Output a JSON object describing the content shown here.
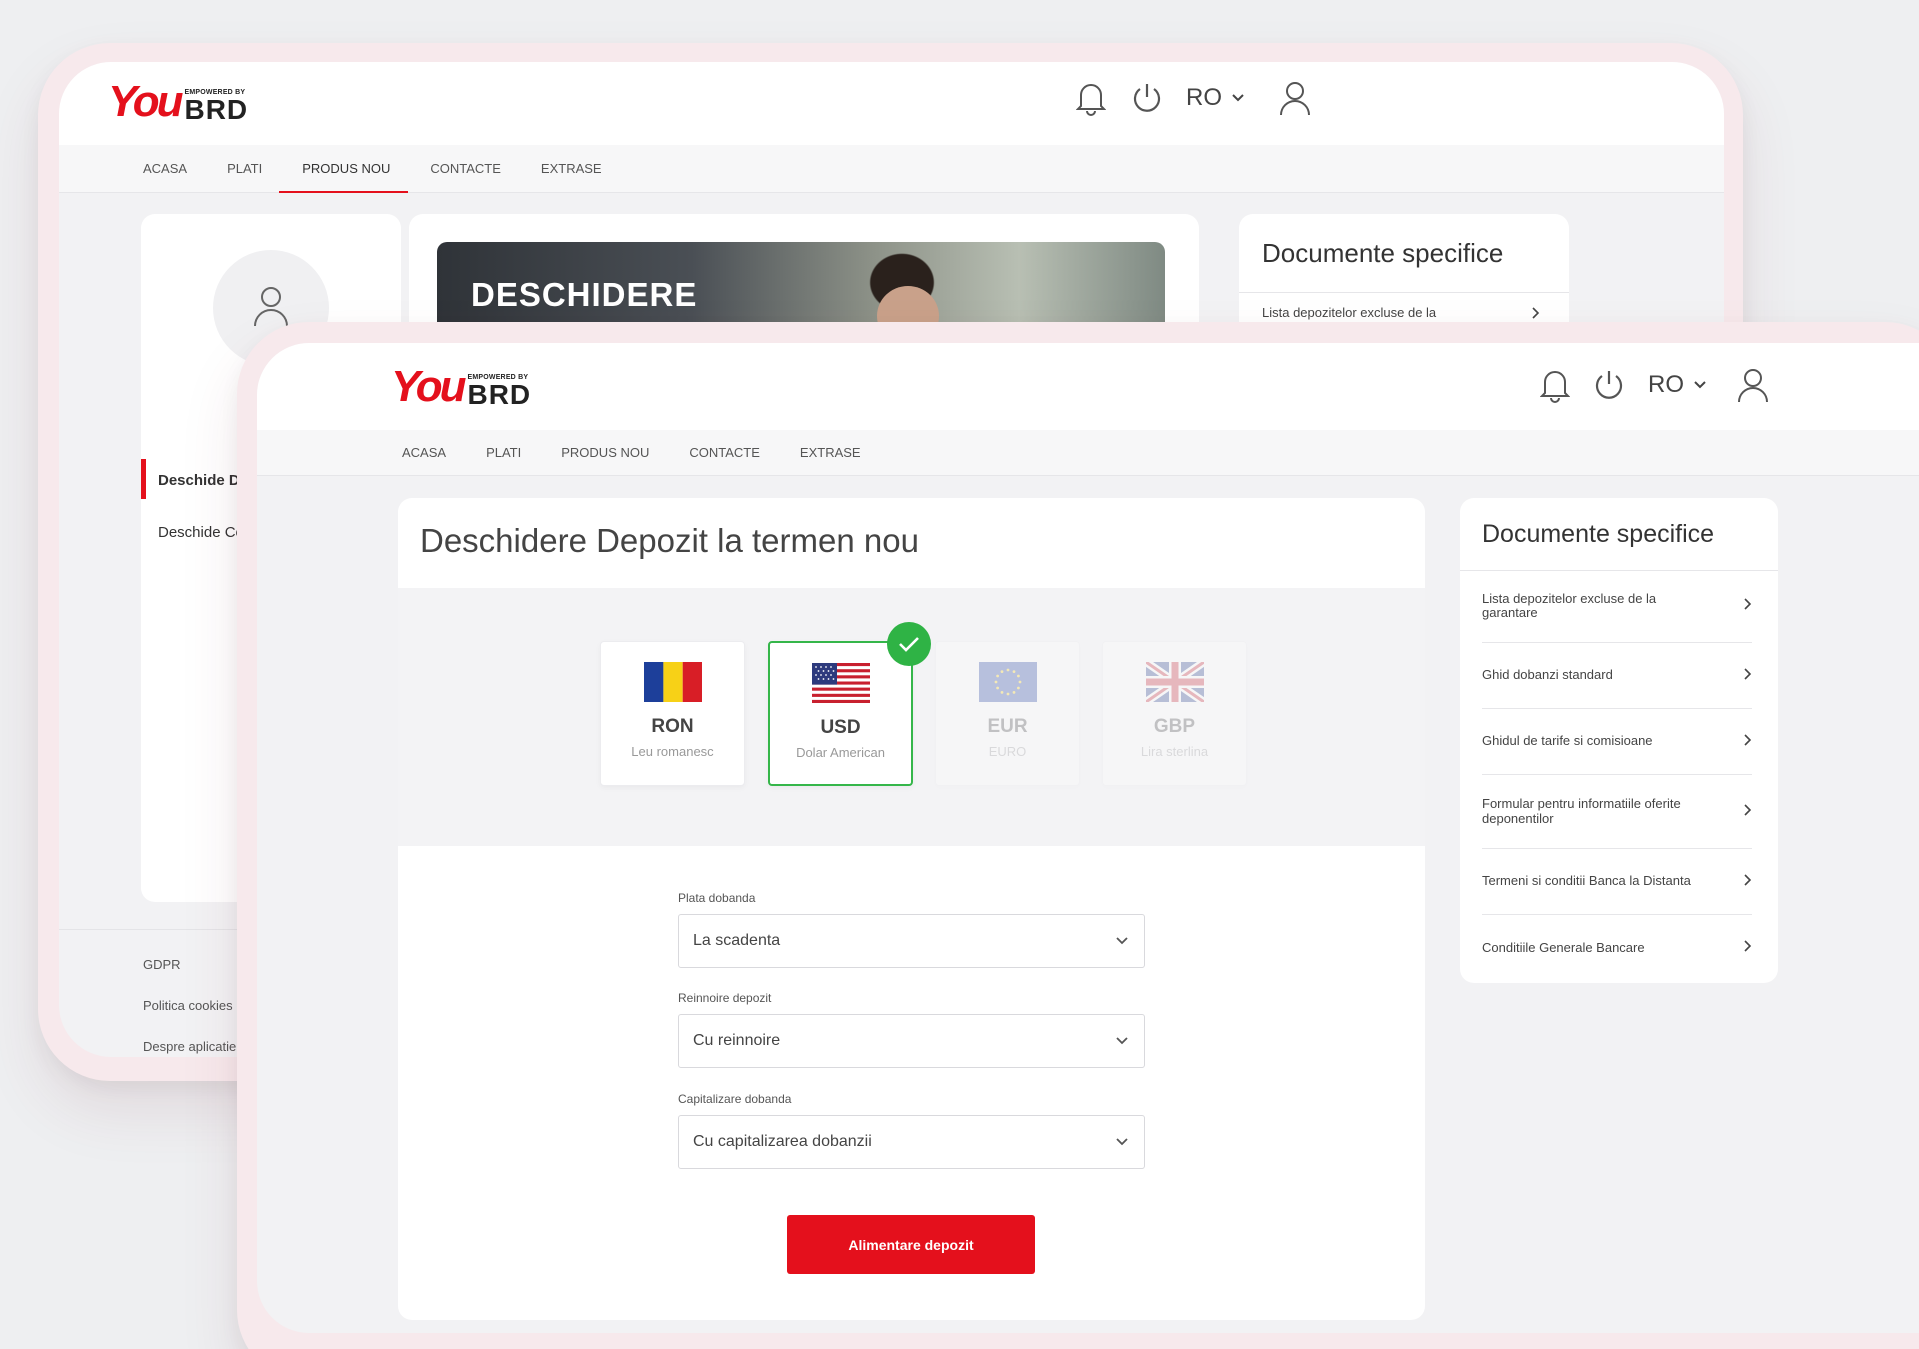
{
  "brand": {
    "logo_main": "You",
    "logo_tag": "EMPOWERED BY",
    "logo_bank": "BRD",
    "accent_color": "#e4101c",
    "success_color": "#2fb345"
  },
  "header": {
    "language": "RO",
    "icons": [
      "bell-icon",
      "power-icon",
      "chevron-down-icon",
      "user-icon"
    ]
  },
  "nav": {
    "items": [
      {
        "label": "ACASA"
      },
      {
        "label": "PLATI"
      },
      {
        "label": "PRODUS NOU"
      },
      {
        "label": "CONTACTE"
      },
      {
        "label": "EXTRASE"
      }
    ],
    "active_index_back": 2
  },
  "back_screen": {
    "banner_title": "DESCHIDERE",
    "sidebar": {
      "items": [
        {
          "label": "Deschide D",
          "active": true
        },
        {
          "label": "Deschide Co",
          "active": false
        }
      ]
    },
    "docs_title": "Documente specifice",
    "docs_first": "Lista depozitelor excluse de la",
    "footer": [
      "GDPR",
      "Politica cookies",
      "Despre aplicatie"
    ]
  },
  "main": {
    "title": "Deschidere Depozit la termen nou",
    "currencies": [
      {
        "code": "RON",
        "name": "Leu romanesc",
        "flag": "ro-flag",
        "state": "available"
      },
      {
        "code": "USD",
        "name": "Dolar American",
        "flag": "us-flag",
        "state": "selected"
      },
      {
        "code": "EUR",
        "name": "EURO",
        "flag": "eu-flag",
        "state": "disabled"
      },
      {
        "code": "GBP",
        "name": "Lira sterlina",
        "flag": "uk-flag",
        "state": "disabled"
      }
    ],
    "fields": [
      {
        "label": "Plata dobanda",
        "value": "La scadenta"
      },
      {
        "label": "Reinnoire depozit",
        "value": "Cu reinnoire"
      },
      {
        "label": "Capitalizare dobanda",
        "value": "Cu capitalizarea dobanzii"
      }
    ],
    "submit_label": "Alimentare depozit"
  },
  "docs": {
    "title": "Documente specifice",
    "items": [
      {
        "label": "Lista depozitelor excluse de la garantare"
      },
      {
        "label": "Ghid dobanzi standard"
      },
      {
        "label": "Ghidul de tarife si comisioane"
      },
      {
        "label": "Formular pentru informatiile oferite deponentilor"
      },
      {
        "label": "Termeni si conditii Banca la Distanta"
      },
      {
        "label": "Conditiile Generale Bancare"
      }
    ]
  }
}
